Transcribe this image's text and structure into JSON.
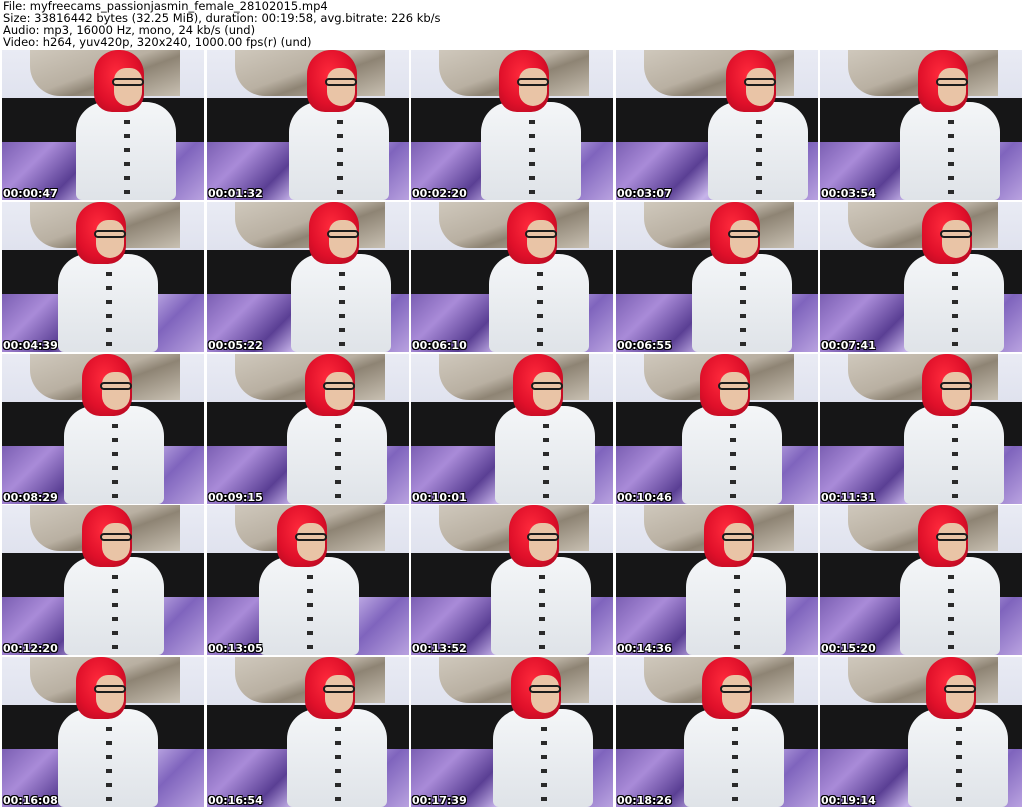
{
  "header": {
    "file": "File: myfreecams_passionjasmin_female_28102015.mp4",
    "size": "Size: 33816442 bytes (32.25 MiB), duration: 00:19:58, avg.bitrate: 226 kb/s",
    "audio": "Audio: mp3, 16000 Hz, mono, 24 kb/s (und)",
    "video": "Video: h264, yuv420p, 320x240, 1000.00 fps(r) (und)"
  },
  "thumbnails": [
    {
      "timestamp": "00:00:47"
    },
    {
      "timestamp": "00:01:32"
    },
    {
      "timestamp": "00:02:20"
    },
    {
      "timestamp": "00:03:07"
    },
    {
      "timestamp": "00:03:54"
    },
    {
      "timestamp": "00:04:39"
    },
    {
      "timestamp": "00:05:22"
    },
    {
      "timestamp": "00:06:10"
    },
    {
      "timestamp": "00:06:55"
    },
    {
      "timestamp": "00:07:41"
    },
    {
      "timestamp": "00:08:29"
    },
    {
      "timestamp": "00:09:15"
    },
    {
      "timestamp": "00:10:01"
    },
    {
      "timestamp": "00:10:46"
    },
    {
      "timestamp": "00:11:31"
    },
    {
      "timestamp": "00:12:20"
    },
    {
      "timestamp": "00:13:05"
    },
    {
      "timestamp": "00:13:52"
    },
    {
      "timestamp": "00:14:36"
    },
    {
      "timestamp": "00:15:20"
    },
    {
      "timestamp": "00:16:08"
    },
    {
      "timestamp": "00:16:54"
    },
    {
      "timestamp": "00:17:39"
    },
    {
      "timestamp": "00:18:26"
    },
    {
      "timestamp": "00:19:14"
    }
  ]
}
